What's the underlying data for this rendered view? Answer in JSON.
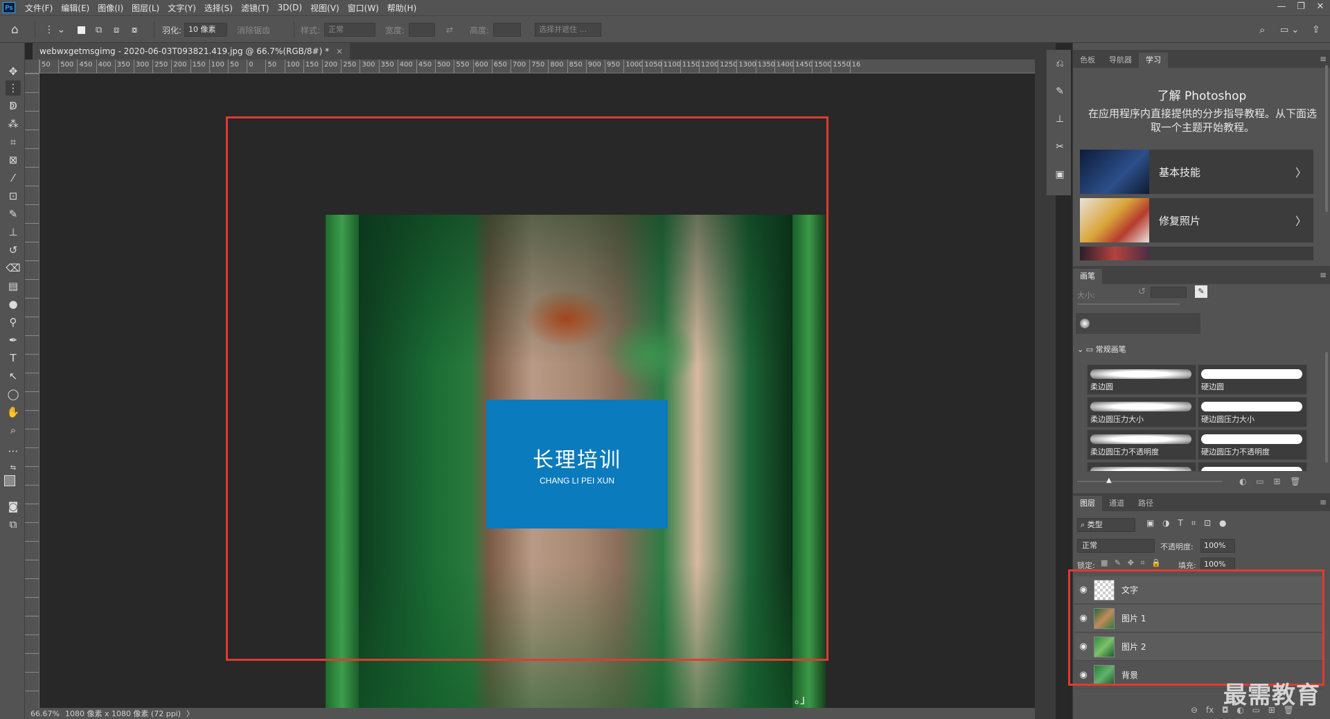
{
  "app": {
    "logo": "Ps"
  },
  "menu": [
    "文件(F)",
    "编辑(E)",
    "图像(I)",
    "图层(L)",
    "文字(Y)",
    "选择(S)",
    "滤镜(T)",
    "3D(D)",
    "视图(V)",
    "窗口(W)",
    "帮助(H)"
  ],
  "window_controls": [
    "—",
    "❐",
    "✕"
  ],
  "options": {
    "feather_label": "羽化:",
    "feather_value": "10 像素",
    "antialias": "消除锯齿",
    "style_label": "样式:",
    "style_value": "正常",
    "width_label": "宽度:",
    "height_label": "高度:",
    "select_mask": "选择并遮住 ..."
  },
  "document": {
    "tab_title": "webwxgetmsgimg - 2020-06-03T093821.419.jpg @ 66.7%(RGB/8#) *",
    "close": "×"
  },
  "ruler_top_labels": [
    "50",
    "500",
    "450",
    "400",
    "350",
    "300",
    "250",
    "200",
    "150",
    "100",
    "50",
    "0",
    "50",
    "100",
    "150",
    "200",
    "250",
    "300",
    "350",
    "400",
    "450",
    "500",
    "550",
    "600",
    "650",
    "700",
    "750",
    "800",
    "850",
    "900",
    "950",
    "1000",
    "1050",
    "1100",
    "1150",
    "1200",
    "1250",
    "1300",
    "1350",
    "1400",
    "1450",
    "1500",
    "1550",
    "16"
  ],
  "artwork": {
    "title_cn": "长理培训",
    "title_en": "CHANG LI PEI XUN",
    "mark": "。」"
  },
  "status": {
    "zoom": "66.67%",
    "doc_size": "1080 像素 x 1080 像素 (72 ppi)",
    "arrow": "〉"
  },
  "learn_panel": {
    "tabs": [
      "色板",
      "导航器",
      "学习"
    ],
    "title": "了解 Photoshop",
    "description": "在应用程序内直接提供的分步指导教程。从下面选取一个主题开始教程。",
    "cards": [
      {
        "label": "基本技能"
      },
      {
        "label": "修复照片"
      }
    ]
  },
  "brush_panel": {
    "tab": "画笔",
    "size_label": "大小:",
    "group": "常规画笔",
    "brushes": [
      "柔边圆",
      "硬边圆",
      "柔边圆压力大小",
      "硬边圆压力大小",
      "柔边圆压力不透明度",
      "硬边圆压力不透明度"
    ]
  },
  "layers_panel": {
    "tabs": [
      "图层",
      "通道",
      "路径"
    ],
    "filter": "类型",
    "blend_mode": "正常",
    "opacity_label": "不透明度:",
    "opacity_value": "100%",
    "lock_label": "锁定:",
    "fill_label": "填充:",
    "fill_value": "100%",
    "layers": [
      {
        "name": "文字"
      },
      {
        "name": "图片 1"
      },
      {
        "name": "图片 2"
      },
      {
        "name": "背景"
      }
    ]
  },
  "watermark": "最需教育",
  "colors": {
    "accent_red": "#e23a32",
    "blue_block": "#0a7bbd",
    "ps_blue": "#31a8ff"
  }
}
